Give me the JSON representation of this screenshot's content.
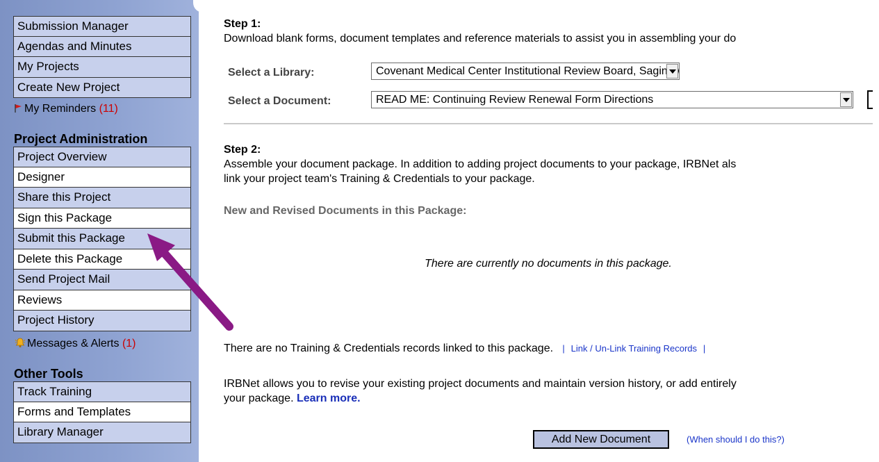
{
  "sidebar": {
    "top_menu": [
      {
        "label": "Submission Manager"
      },
      {
        "label": "Agendas and Minutes"
      },
      {
        "label": "My Projects"
      },
      {
        "label": "Create New Project"
      }
    ],
    "reminders": {
      "label": "My Reminders",
      "count": "(11)"
    },
    "project_admin_heading": "Project Administration",
    "project_admin_menu": [
      {
        "label": "Project Overview"
      },
      {
        "label": "Designer"
      },
      {
        "label": "Share this Project"
      },
      {
        "label": "Sign this Package"
      },
      {
        "label": "Submit this Package"
      },
      {
        "label": "Delete this Package"
      },
      {
        "label": "Send Project Mail"
      },
      {
        "label": "Reviews"
      },
      {
        "label": "Project History"
      }
    ],
    "messages": {
      "label": "Messages & Alerts",
      "count": "(1)"
    },
    "other_tools_heading": "Other Tools",
    "other_tools_menu": [
      {
        "label": "Track Training"
      },
      {
        "label": "Forms and Templates"
      },
      {
        "label": "Library Manager"
      }
    ]
  },
  "main": {
    "step1": {
      "title": "Step 1:",
      "description": "Download blank forms, document templates and reference materials to assist you in assembling your do",
      "library_label": "Select a Library:",
      "library_value": "Covenant Medical Center Institutional Review Board, Saginaw, MI",
      "document_label": "Select a Document:",
      "document_value": "READ ME: Continuing Review Renewal Form Directions"
    },
    "step2": {
      "title": "Step 2:",
      "description_line1": "Assemble your document package. In addition to adding project documents to your package, IRBNet als",
      "description_line2": "link your project team's Training & Credentials to your package.",
      "package_heading": "New and Revised Documents in this Package:",
      "empty_message": "There are currently no documents in this package.",
      "training_text": "There are no Training & Credentials records linked to this package.",
      "training_link": "Link / Un-Link Training Records",
      "pipe": "|",
      "revise_line1": "IRBNet allows you to revise your existing project documents and maintain version history, or add entirely",
      "revise_line2": "your package.",
      "learn_more": "Learn more.",
      "add_button": "Add New Document",
      "when_link": "(When should I do this?)"
    }
  },
  "colors": {
    "sidebar_bg": "#8fa3d2",
    "nav_alt_bg": "#c7d0ec",
    "count_red": "#cc0000",
    "link_blue": "#1a35c9",
    "arrow_purple": "#8a1a85",
    "button_bg": "#b9c2e0"
  }
}
